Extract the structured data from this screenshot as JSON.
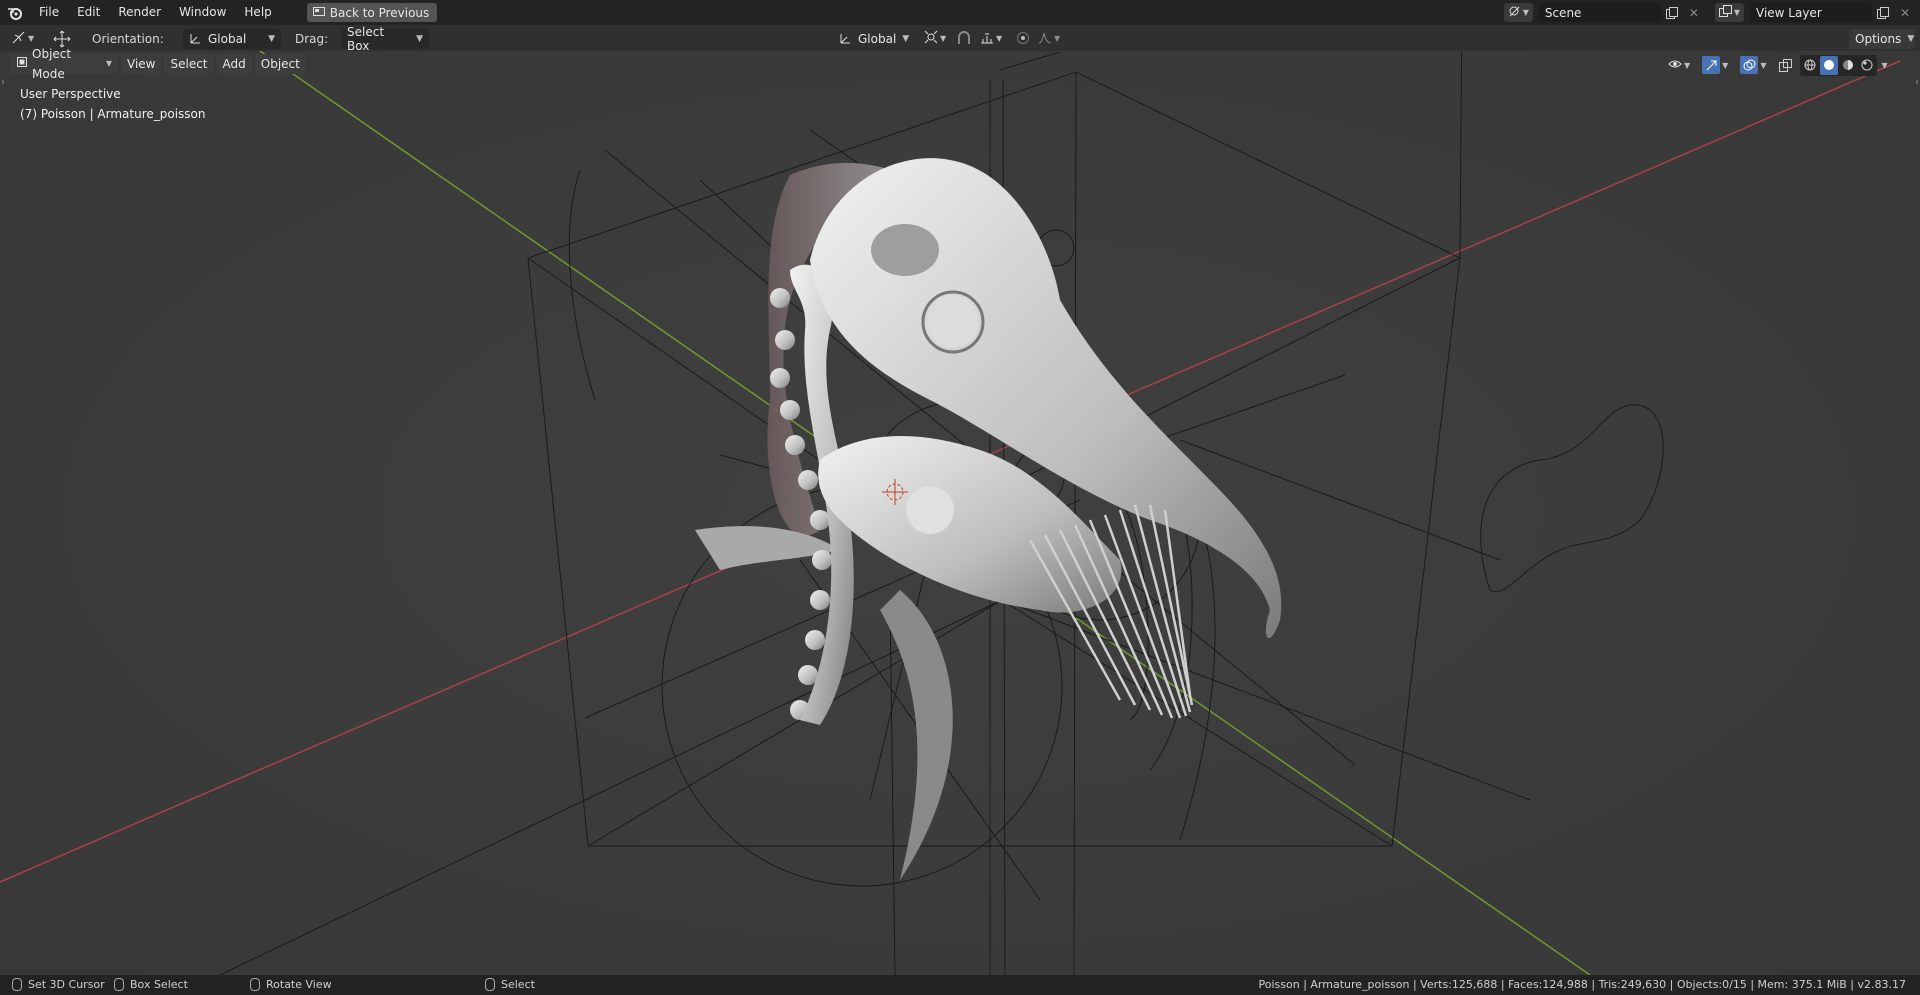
{
  "menu": {
    "items": [
      "File",
      "Edit",
      "Render",
      "Window",
      "Help"
    ],
    "back_label": "Back to Previous"
  },
  "top_right": {
    "scene_value": "Scene",
    "view_layer_value": "View Layer"
  },
  "tool_header": {
    "orientation_label": "Orientation:",
    "orientation_value": "Global",
    "drag_label": "Drag:",
    "drag_value": "Select Box",
    "transform_orientation_value": "Global",
    "options_label": "Options"
  },
  "viewport_header": {
    "mode_label": "Object Mode",
    "view_label": "View",
    "select_label": "Select",
    "add_label": "Add",
    "object_label": "Object"
  },
  "viewport": {
    "perspective_text": "User Perspective",
    "object_text": "(7) Poisson | Armature_poisson"
  },
  "statusbar": {
    "set_cursor": "Set 3D Cursor",
    "box_select": "Box Select",
    "rotate_view": "Rotate View",
    "select": "Select",
    "info": "Poisson | Armature_poisson | Verts:125,688 | Faces:124,988 | Tris:249,630 | Objects:0/15 | Mem: 375.1 MiB | v2.83.17"
  },
  "colors": {
    "x_axis": "#a8404c",
    "y_axis": "#6e9a2e",
    "viewport_bg": "#3d3d3d",
    "header_bg": "#232323"
  }
}
